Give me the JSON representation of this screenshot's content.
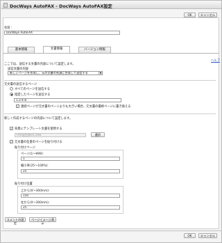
{
  "window": {
    "title": "DocWays AutoFAX - DocWays AutoFAX設定"
  },
  "buttons": {
    "ok": "OK",
    "cancel": "キャンセル",
    "comment": "コメントの設定",
    "preview": "ページイメージ表示",
    "browse": "選択"
  },
  "name": {
    "label": "名前 :",
    "value": "DocWays AutoFAX"
  },
  "tabs": [
    {
      "label": "基本情報"
    },
    {
      "label": "文書情報",
      "active": true
    },
    {
      "label": "バージョン情報"
    }
  ],
  "help": "ヘルプ",
  "send_content": {
    "intro": "ここでは、送信する文書の内容について設定します。",
    "label": "送信文書の内容",
    "selected": "新しいページを作成し、元の文書の先頭に合成して送信する"
  },
  "source_pages": {
    "heading": "元文書の送信するページ",
    "all_label": "すべてのページを送信する",
    "specified_label": "指定したページを送信する",
    "pages_value": "1,3-4-8",
    "replace_label": "連続ページが元文書のページよりも大きい場合、元文書の最終ページに置き換える"
  },
  "new_page": {
    "heading": "新しく作成するページの内容について設定します。",
    "template_label": "背景にテンプレート文書を使用する",
    "template_placeholder": "FAX送信票01.xdw",
    "attach_label": "元文書の任意のページを貼り付ける",
    "attach_page_label": "貼り付けページ",
    "page_range_label": "ページ(1〜999):",
    "page_value": "1",
    "scale_label": "縮小率(25〜100%):",
    "scale_value": "25",
    "position_label": "貼り付け位置",
    "top_label": "上から(0〜300mm):",
    "top_value": "150",
    "left_label": "左から(0〜300mm):",
    "left_value": "25"
  }
}
